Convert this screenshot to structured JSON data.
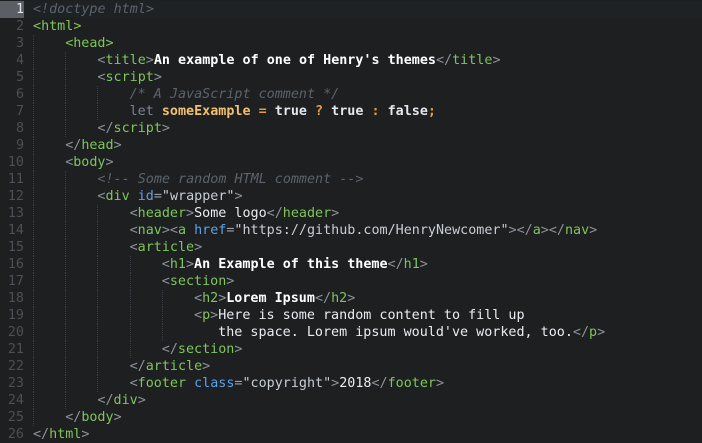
{
  "editor": {
    "language": "html",
    "current_line": 1,
    "colors": {
      "background": "#1d1f21",
      "tag": "#7ec65a",
      "attribute": "#5ea1e6",
      "comment": "#5b636b",
      "variable": "#f0c070",
      "operator": "#e89a3c"
    },
    "lines": [
      {
        "num": "1",
        "indent": 0,
        "tokens": [
          {
            "t": "<!doctype html>",
            "c": "comment"
          }
        ]
      },
      {
        "num": "2",
        "indent": 0,
        "tokens": [
          {
            "t": "<",
            "c": "tag"
          },
          {
            "t": "html",
            "c": "tag"
          },
          {
            "t": ">",
            "c": "tag"
          }
        ]
      },
      {
        "num": "3",
        "indent": 1,
        "tokens": [
          {
            "t": "<",
            "c": "tag"
          },
          {
            "t": "head",
            "c": "tag"
          },
          {
            "t": ">",
            "c": "tag"
          }
        ]
      },
      {
        "num": "4",
        "indent": 2,
        "tokens": [
          {
            "t": "<",
            "c": "bracket"
          },
          {
            "t": "title",
            "c": "tag"
          },
          {
            "t": ">",
            "c": "bracket"
          },
          {
            "t": "An example of one of Henry's themes",
            "c": "bold"
          },
          {
            "t": "</",
            "c": "bracket"
          },
          {
            "t": "title",
            "c": "tag"
          },
          {
            "t": ">",
            "c": "bracket"
          }
        ]
      },
      {
        "num": "5",
        "indent": 2,
        "tokens": [
          {
            "t": "<",
            "c": "bracket"
          },
          {
            "t": "script",
            "c": "tag"
          },
          {
            "t": ">",
            "c": "bracket"
          }
        ]
      },
      {
        "num": "6",
        "indent": 3,
        "tokens": [
          {
            "t": "/* A JavaScript comment */",
            "c": "comment"
          }
        ]
      },
      {
        "num": "7",
        "indent": 3,
        "tokens": [
          {
            "t": "let ",
            "c": "kw"
          },
          {
            "t": "someExample",
            "c": "var"
          },
          {
            "t": " = ",
            "c": "op"
          },
          {
            "t": "true",
            "c": "bool"
          },
          {
            "t": " ? ",
            "c": "op"
          },
          {
            "t": "true",
            "c": "bool"
          },
          {
            "t": " : ",
            "c": "op"
          },
          {
            "t": "false",
            "c": "bool"
          },
          {
            "t": ";",
            "c": "op"
          }
        ]
      },
      {
        "num": "8",
        "indent": 2,
        "tokens": [
          {
            "t": "</",
            "c": "bracket"
          },
          {
            "t": "script",
            "c": "tag"
          },
          {
            "t": ">",
            "c": "bracket"
          }
        ]
      },
      {
        "num": "9",
        "indent": 1,
        "tokens": [
          {
            "t": "</",
            "c": "bracket"
          },
          {
            "t": "head",
            "c": "tag"
          },
          {
            "t": ">",
            "c": "bracket"
          }
        ]
      },
      {
        "num": "10",
        "indent": 1,
        "tokens": [
          {
            "t": "<",
            "c": "bracket"
          },
          {
            "t": "body",
            "c": "tag"
          },
          {
            "t": ">",
            "c": "bracket"
          }
        ]
      },
      {
        "num": "11",
        "indent": 2,
        "tokens": [
          {
            "t": "<!-- Some random HTML comment -->",
            "c": "comment"
          }
        ]
      },
      {
        "num": "12",
        "indent": 2,
        "tokens": [
          {
            "t": "<",
            "c": "bracket"
          },
          {
            "t": "div",
            "c": "tag"
          },
          {
            "t": " ",
            "c": "text"
          },
          {
            "t": "id",
            "c": "attr"
          },
          {
            "t": "=",
            "c": "punct"
          },
          {
            "t": "\"wrapper\"",
            "c": "str"
          },
          {
            "t": ">",
            "c": "bracket"
          }
        ]
      },
      {
        "num": "13",
        "indent": 3,
        "tokens": [
          {
            "t": "<",
            "c": "bracket"
          },
          {
            "t": "header",
            "c": "tag"
          },
          {
            "t": ">",
            "c": "bracket"
          },
          {
            "t": "Some logo",
            "c": "text"
          },
          {
            "t": "</",
            "c": "bracket"
          },
          {
            "t": "header",
            "c": "tag"
          },
          {
            "t": ">",
            "c": "bracket"
          }
        ]
      },
      {
        "num": "14",
        "indent": 3,
        "tokens": [
          {
            "t": "<",
            "c": "bracket"
          },
          {
            "t": "nav",
            "c": "tag"
          },
          {
            "t": "><",
            "c": "bracket"
          },
          {
            "t": "a",
            "c": "tag"
          },
          {
            "t": " ",
            "c": "text"
          },
          {
            "t": "href",
            "c": "attr"
          },
          {
            "t": "=",
            "c": "punct"
          },
          {
            "t": "\"https://github.com/HenryNewcomer\"",
            "c": "str"
          },
          {
            "t": "></",
            "c": "bracket"
          },
          {
            "t": "a",
            "c": "tag"
          },
          {
            "t": "></",
            "c": "bracket"
          },
          {
            "t": "nav",
            "c": "tag"
          },
          {
            "t": ">",
            "c": "bracket"
          }
        ]
      },
      {
        "num": "15",
        "indent": 3,
        "tokens": [
          {
            "t": "<",
            "c": "bracket"
          },
          {
            "t": "article",
            "c": "tag"
          },
          {
            "t": ">",
            "c": "bracket"
          }
        ]
      },
      {
        "num": "16",
        "indent": 4,
        "tokens": [
          {
            "t": "<",
            "c": "bracket"
          },
          {
            "t": "h1",
            "c": "tag"
          },
          {
            "t": ">",
            "c": "bracket"
          },
          {
            "t": "An Example of this theme",
            "c": "bold"
          },
          {
            "t": "</",
            "c": "bracket"
          },
          {
            "t": "h1",
            "c": "tag"
          },
          {
            "t": ">",
            "c": "bracket"
          }
        ]
      },
      {
        "num": "17",
        "indent": 4,
        "tokens": [
          {
            "t": "<",
            "c": "bracket"
          },
          {
            "t": "section",
            "c": "tag"
          },
          {
            "t": ">",
            "c": "bracket"
          }
        ]
      },
      {
        "num": "18",
        "indent": 5,
        "tokens": [
          {
            "t": "<",
            "c": "bracket"
          },
          {
            "t": "h2",
            "c": "tag"
          },
          {
            "t": ">",
            "c": "bracket"
          },
          {
            "t": "Lorem Ipsum",
            "c": "bold"
          },
          {
            "t": "</",
            "c": "bracket"
          },
          {
            "t": "h2",
            "c": "tag"
          },
          {
            "t": ">",
            "c": "bracket"
          }
        ]
      },
      {
        "num": "19",
        "indent": 5,
        "tokens": [
          {
            "t": "<",
            "c": "bracket"
          },
          {
            "t": "p",
            "c": "tag"
          },
          {
            "t": ">",
            "c": "bracket"
          },
          {
            "t": "Here is some random content to fill up",
            "c": "text"
          }
        ]
      },
      {
        "num": "20",
        "indent": 5,
        "tokens": [
          {
            "t": "   the space. Lorem ipsum would've worked, too.",
            "c": "text"
          },
          {
            "t": "</",
            "c": "bracket"
          },
          {
            "t": "p",
            "c": "tag"
          },
          {
            "t": ">",
            "c": "bracket"
          }
        ]
      },
      {
        "num": "21",
        "indent": 4,
        "tokens": [
          {
            "t": "</",
            "c": "bracket"
          },
          {
            "t": "section",
            "c": "tag"
          },
          {
            "t": ">",
            "c": "bracket"
          }
        ]
      },
      {
        "num": "22",
        "indent": 3,
        "tokens": [
          {
            "t": "</",
            "c": "bracket"
          },
          {
            "t": "article",
            "c": "tag"
          },
          {
            "t": ">",
            "c": "bracket"
          }
        ]
      },
      {
        "num": "23",
        "indent": 3,
        "tokens": [
          {
            "t": "<",
            "c": "bracket"
          },
          {
            "t": "footer",
            "c": "tag"
          },
          {
            "t": " ",
            "c": "text"
          },
          {
            "t": "class",
            "c": "attr"
          },
          {
            "t": "=",
            "c": "punct"
          },
          {
            "t": "\"copyright\"",
            "c": "str"
          },
          {
            "t": ">",
            "c": "bracket"
          },
          {
            "t": "2018",
            "c": "text"
          },
          {
            "t": "</",
            "c": "bracket"
          },
          {
            "t": "footer",
            "c": "tag"
          },
          {
            "t": ">",
            "c": "bracket"
          }
        ]
      },
      {
        "num": "24",
        "indent": 2,
        "tokens": [
          {
            "t": "</",
            "c": "bracket"
          },
          {
            "t": "div",
            "c": "tag"
          },
          {
            "t": ">",
            "c": "bracket"
          }
        ]
      },
      {
        "num": "25",
        "indent": 1,
        "tokens": [
          {
            "t": "</",
            "c": "bracket"
          },
          {
            "t": "body",
            "c": "tag"
          },
          {
            "t": ">",
            "c": "bracket"
          }
        ]
      },
      {
        "num": "26",
        "indent": 0,
        "tokens": [
          {
            "t": "</",
            "c": "bracket"
          },
          {
            "t": "html",
            "c": "tag"
          },
          {
            "t": ">",
            "c": "bracket"
          }
        ]
      }
    ]
  }
}
